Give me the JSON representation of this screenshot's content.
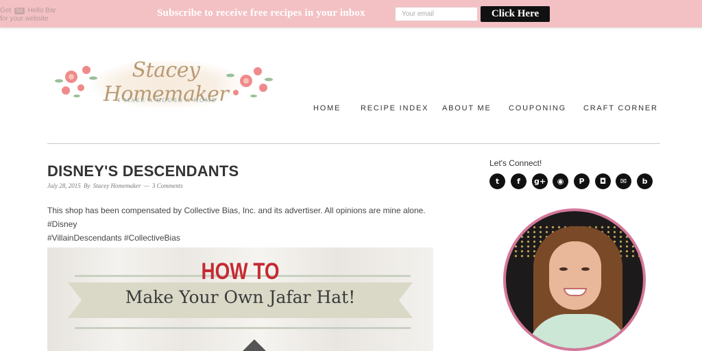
{
  "hello_bar": {
    "get_label": "Get",
    "badge": "84",
    "brand": "Hello Bar",
    "sub": "for your website",
    "message": "Subscribe to receive free recipes in your inbox",
    "email_placeholder": "Your email",
    "button_label": "Click Here",
    "bg_color": "#f3c1c4"
  },
  "logo": {
    "title": "Stacey Homemaker",
    "tagline": "I MAKE A HOUSE A HOME"
  },
  "nav": {
    "items": [
      "HOME",
      "RECIPE INDEX",
      "ABOUT ME",
      "COUPONING",
      "CRAFT CORNER"
    ]
  },
  "post": {
    "title": "DISNEY'S DESCENDANTS",
    "date": "July 28, 2015",
    "by": "By",
    "author": "Stacey Homemaker",
    "sep": "—",
    "comments": "3 Comments",
    "body_line1": "This shop has been compensated by Collective Bias, Inc. and its advertiser. All opinions are mine alone. #Disney",
    "body_line2": "#VillainDescendants #CollectiveBias",
    "image": {
      "heading": "HOW TO",
      "subheading": "Make Your Own Jafar Hat!"
    }
  },
  "sidebar": {
    "connect_title": "Let's Connect!",
    "social_icons": [
      "twitter-icon",
      "facebook-icon",
      "google-plus-icon",
      "rss-icon",
      "pinterest-icon",
      "instagram-icon",
      "email-icon",
      "bloglovin-icon"
    ],
    "social_glyphs": [
      "t",
      "f",
      "g+",
      "◉",
      "P",
      "◘",
      "✉",
      "b"
    ],
    "avatar_border_color": "#d4779b"
  }
}
